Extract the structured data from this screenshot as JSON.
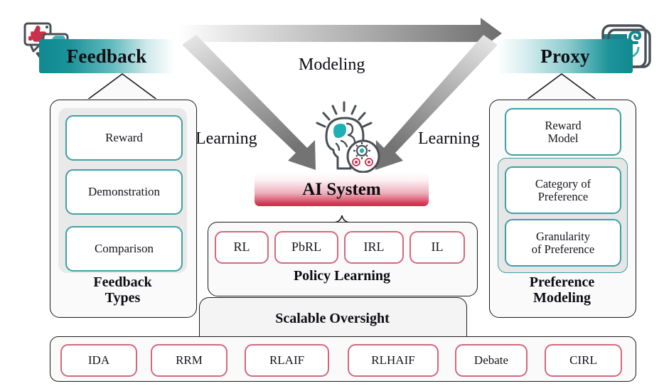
{
  "diagram": {
    "title": "Feedback to Proxy AI alignment overview",
    "colors": {
      "teal": "#3f9fa6",
      "teal_deep": "#0e8a90",
      "pink": "#d4687e",
      "crimson": "#cc2f4b",
      "gray_arrow": "#808080",
      "panel_bg": "#fafafa",
      "outline": "#1b1b1b"
    }
  },
  "banners": {
    "feedback": {
      "label": "Feedback",
      "icon": "feedback-thumbs-icon"
    },
    "proxy": {
      "label": "Proxy",
      "icon": "function-f-icon"
    }
  },
  "center": {
    "ai_system_label": "AI System",
    "brain_icon": "brain-gears-icon"
  },
  "arrows": {
    "top_label": "Modeling",
    "left_label": "Learning",
    "right_label": "Learning"
  },
  "feedback_panel": {
    "caption_line1": "Feedback",
    "caption_line2": "Types",
    "items": [
      {
        "label": "Reward"
      },
      {
        "label": "Demonstration"
      },
      {
        "label": "Comparison"
      }
    ]
  },
  "preference_panel": {
    "caption_line1": "Preference",
    "caption_line2": "Modeling",
    "reward_model": {
      "line1": "Reward",
      "line2": "Model"
    },
    "items": [
      {
        "line1": "Category of",
        "line2": "Preference"
      },
      {
        "line1": "Granularity",
        "line2": "of Preference"
      }
    ]
  },
  "policy_panel": {
    "caption": "Policy Learning",
    "items": [
      {
        "label": "RL"
      },
      {
        "label": "PbRL"
      },
      {
        "label": "IRL"
      },
      {
        "label": "IL"
      }
    ]
  },
  "oversight_panel": {
    "caption": "Scalable Oversight",
    "items": [
      {
        "label": "IDA"
      },
      {
        "label": "RRM"
      },
      {
        "label": "RLAIF"
      },
      {
        "label": "RLHAIF"
      },
      {
        "label": "Debate"
      },
      {
        "label": "CIRL"
      }
    ]
  }
}
